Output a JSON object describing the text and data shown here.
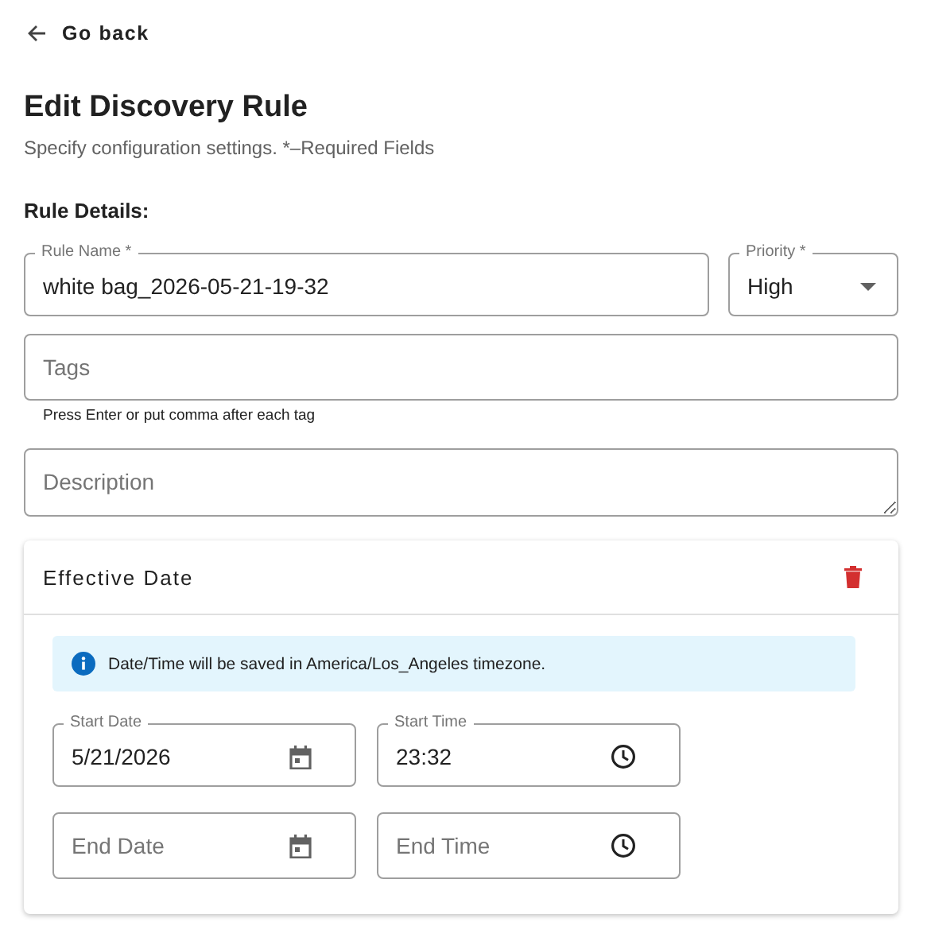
{
  "back_link": {
    "label": "Go back"
  },
  "heading": "Edit Discovery Rule",
  "subtitle": "Specify configuration settings. *–Required Fields",
  "section_title": "Rule Details:",
  "fields": [
    {
      "kind": "text",
      "label": "Rule Name *",
      "value": "white bag_2026-05-21-19-32"
    },
    {
      "kind": "select",
      "label": "Priority *",
      "value": "High"
    }
  ],
  "tags": {
    "placeholder": "Tags",
    "helper": "Press Enter or put comma after each tag"
  },
  "description": {
    "placeholder": "Description"
  },
  "effective_date": {
    "title": "Effective Date",
    "info": "Date/Time will be saved in America/Los_Angeles timezone.",
    "fields": [
      {
        "kind": "date",
        "label": "Start Date",
        "value": "5/21/2026"
      },
      {
        "kind": "time",
        "label": "Start Time",
        "value": "23:32"
      },
      {
        "kind": "date",
        "placeholder": "End Date"
      },
      {
        "kind": "time",
        "placeholder": "End Time"
      }
    ]
  }
}
